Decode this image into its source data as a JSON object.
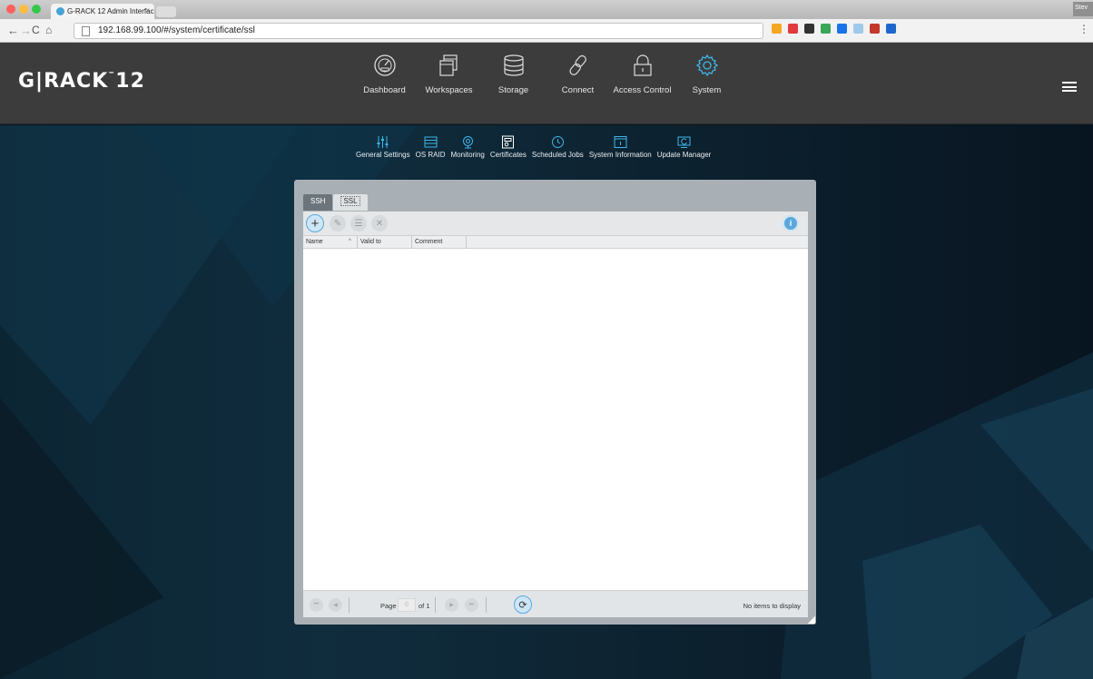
{
  "browser": {
    "tab_title": "G-RACK 12 Admin Interfac",
    "tab_close": "×",
    "url": "192.168.99.100/#/system/certificate/ssl",
    "user_label": "Stev"
  },
  "header": {
    "logo": "G|RACK",
    "logo_tm": "™",
    "logo_num": "12",
    "nav": [
      {
        "label": "Dashboard",
        "icon": "dashboard-icon"
      },
      {
        "label": "Workspaces",
        "icon": "workspaces-icon"
      },
      {
        "label": "Storage",
        "icon": "storage-icon"
      },
      {
        "label": "Connect",
        "icon": "link-icon"
      },
      {
        "label": "Access Control",
        "icon": "lock-icon"
      },
      {
        "label": "System",
        "icon": "gear-icon"
      }
    ],
    "active_nav": "System"
  },
  "subnav": [
    {
      "label": "General Settings",
      "icon": "sliders-icon"
    },
    {
      "label": "OS RAID",
      "icon": "raid-icon"
    },
    {
      "label": "Monitoring",
      "icon": "monitoring-icon"
    },
    {
      "label": "Certificates",
      "icon": "certificate-icon"
    },
    {
      "label": "Scheduled Jobs",
      "icon": "clock-icon"
    },
    {
      "label": "System Information",
      "icon": "info-window-icon"
    },
    {
      "label": "Update Manager",
      "icon": "update-icon"
    }
  ],
  "panel": {
    "tabs": [
      "SSH",
      "SSL"
    ],
    "active_tab": "SSL",
    "columns": [
      "Name",
      "Valid to",
      "Comment"
    ],
    "sort_column": "Name",
    "rows": [],
    "pager": {
      "page_label": "Page",
      "page_value": "0",
      "of_label": "of 1",
      "status": "No items to display"
    }
  },
  "colors": {
    "header_bg": "#3c3c3c",
    "accent": "#5aa7dc",
    "active_icon": "#3fb6e8"
  }
}
